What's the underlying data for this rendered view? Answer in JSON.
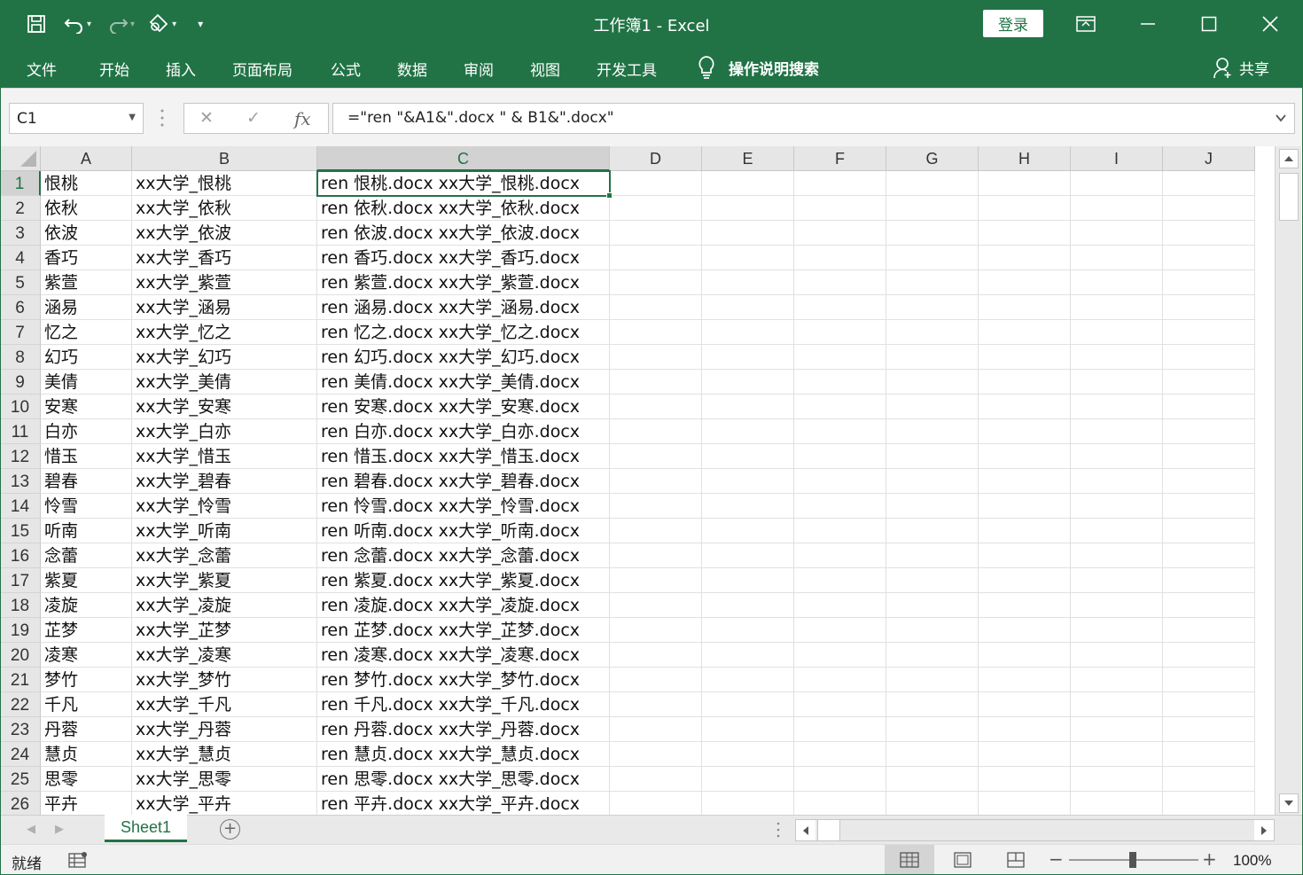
{
  "window": {
    "title": "工作簿1  -  Excel",
    "login_label": "登录",
    "qat_icons": [
      "save-icon",
      "undo-icon",
      "redo-icon",
      "touch-mode-icon",
      "customize-qat-icon"
    ],
    "controls": [
      "ribbon-display-icon",
      "minimize-icon",
      "maximize-icon",
      "close-icon"
    ]
  },
  "ribbon": {
    "tabs": [
      "文件",
      "开始",
      "插入",
      "页面布局",
      "公式",
      "数据",
      "审阅",
      "视图",
      "开发工具"
    ],
    "tell_me": "操作说明搜索",
    "share": "共享"
  },
  "formula_bar": {
    "name_box": "C1",
    "formula": "=\"ren \"&A1&\".docx \" & B1&\".docx\"",
    "fx_label": "fx"
  },
  "sheet": {
    "columns": [
      "A",
      "B",
      "C",
      "D",
      "E",
      "F",
      "G",
      "H",
      "I",
      "J"
    ],
    "selected_column": "C",
    "selected_cell": "C1",
    "rows": [
      {
        "n": "1",
        "a": "恨桃",
        "b": "xx大学_恨桃",
        "c": "ren 恨桃.docx xx大学_恨桃.docx"
      },
      {
        "n": "2",
        "a": "依秋",
        "b": "xx大学_依秋",
        "c": "ren 依秋.docx xx大学_依秋.docx"
      },
      {
        "n": "3",
        "a": "依波",
        "b": "xx大学_依波",
        "c": "ren 依波.docx xx大学_依波.docx"
      },
      {
        "n": "4",
        "a": "香巧",
        "b": "xx大学_香巧",
        "c": "ren 香巧.docx xx大学_香巧.docx"
      },
      {
        "n": "5",
        "a": "紫萱",
        "b": "xx大学_紫萱",
        "c": "ren 紫萱.docx xx大学_紫萱.docx"
      },
      {
        "n": "6",
        "a": "涵易",
        "b": "xx大学_涵易",
        "c": "ren 涵易.docx xx大学_涵易.docx"
      },
      {
        "n": "7",
        "a": "忆之",
        "b": "xx大学_忆之",
        "c": "ren 忆之.docx xx大学_忆之.docx"
      },
      {
        "n": "8",
        "a": "幻巧",
        "b": "xx大学_幻巧",
        "c": "ren 幻巧.docx xx大学_幻巧.docx"
      },
      {
        "n": "9",
        "a": "美倩",
        "b": "xx大学_美倩",
        "c": "ren 美倩.docx xx大学_美倩.docx"
      },
      {
        "n": "10",
        "a": "安寒",
        "b": "xx大学_安寒",
        "c": "ren 安寒.docx xx大学_安寒.docx"
      },
      {
        "n": "11",
        "a": "白亦",
        "b": "xx大学_白亦",
        "c": "ren 白亦.docx xx大学_白亦.docx"
      },
      {
        "n": "12",
        "a": "惜玉",
        "b": "xx大学_惜玉",
        "c": "ren 惜玉.docx xx大学_惜玉.docx"
      },
      {
        "n": "13",
        "a": "碧春",
        "b": "xx大学_碧春",
        "c": "ren 碧春.docx xx大学_碧春.docx"
      },
      {
        "n": "14",
        "a": "怜雪",
        "b": "xx大学_怜雪",
        "c": "ren 怜雪.docx xx大学_怜雪.docx"
      },
      {
        "n": "15",
        "a": "听南",
        "b": "xx大学_听南",
        "c": "ren 听南.docx xx大学_听南.docx"
      },
      {
        "n": "16",
        "a": "念蕾",
        "b": "xx大学_念蕾",
        "c": "ren 念蕾.docx xx大学_念蕾.docx"
      },
      {
        "n": "17",
        "a": "紫夏",
        "b": "xx大学_紫夏",
        "c": "ren 紫夏.docx xx大学_紫夏.docx"
      },
      {
        "n": "18",
        "a": "凌旋",
        "b": "xx大学_凌旋",
        "c": "ren 凌旋.docx xx大学_凌旋.docx"
      },
      {
        "n": "19",
        "a": "芷梦",
        "b": "xx大学_芷梦",
        "c": "ren 芷梦.docx xx大学_芷梦.docx"
      },
      {
        "n": "20",
        "a": "凌寒",
        "b": "xx大学_凌寒",
        "c": "ren 凌寒.docx xx大学_凌寒.docx"
      },
      {
        "n": "21",
        "a": "梦竹",
        "b": "xx大学_梦竹",
        "c": "ren 梦竹.docx xx大学_梦竹.docx"
      },
      {
        "n": "22",
        "a": "千凡",
        "b": "xx大学_千凡",
        "c": "ren 千凡.docx xx大学_千凡.docx"
      },
      {
        "n": "23",
        "a": "丹蓉",
        "b": "xx大学_丹蓉",
        "c": "ren 丹蓉.docx xx大学_丹蓉.docx"
      },
      {
        "n": "24",
        "a": "慧贞",
        "b": "xx大学_慧贞",
        "c": "ren 慧贞.docx xx大学_慧贞.docx"
      },
      {
        "n": "25",
        "a": "思零",
        "b": "xx大学_思零",
        "c": "ren 思零.docx xx大学_思零.docx"
      },
      {
        "n": "26",
        "a": "平卉",
        "b": "xx大学_平卉",
        "c": "ren 平卉.docx xx大学_平卉.docx"
      }
    ]
  },
  "sheet_tabs": [
    "Sheet1"
  ],
  "status": {
    "ready": "就绪",
    "zoom": "100%",
    "views": [
      "normal-view-icon",
      "page-layout-view-icon",
      "page-break-view-icon"
    ]
  },
  "colors": {
    "accent": "#217346",
    "header_bg": "#e6e6e6",
    "selected_header_bg": "#d2d2d2"
  }
}
